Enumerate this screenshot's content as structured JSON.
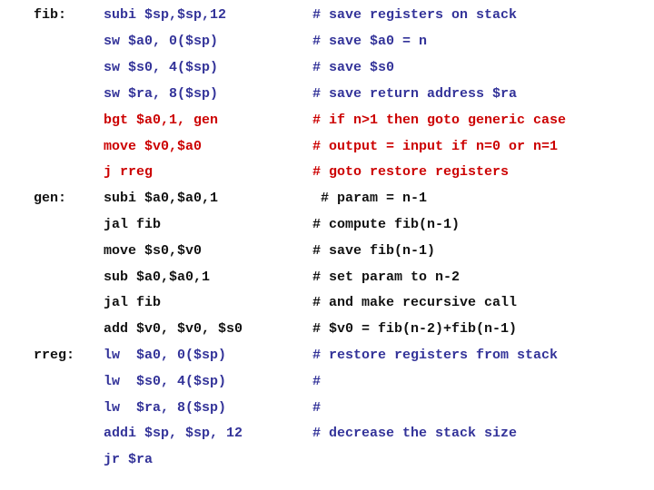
{
  "colors": {
    "blue": "#333399",
    "red": "#cc0000",
    "black": "#111111"
  },
  "lines": [
    {
      "label": "fib:",
      "code": "subi $sp,$sp,12",
      "comment": "# save registers on stack",
      "color": "blue"
    },
    {
      "label": "",
      "code": "sw $a0, 0($sp)",
      "comment": "# save $a0 = n",
      "color": "blue"
    },
    {
      "label": "",
      "code": "sw $s0, 4($sp)",
      "comment": "# save $s0",
      "color": "blue"
    },
    {
      "label": "",
      "code": "sw $ra, 8($sp)",
      "comment": "# save return address $ra",
      "color": "blue"
    },
    {
      "label": "",
      "code": "bgt $a0,1, gen",
      "comment": "# if n>1 then goto generic case",
      "color": "red"
    },
    {
      "label": "",
      "code": "move $v0,$a0",
      "comment": "# output = input if n=0 or n=1",
      "color": "red"
    },
    {
      "label": "",
      "code": "j rreg",
      "comment": "# goto restore registers",
      "color": "red"
    },
    {
      "label": "gen:",
      "code": "subi $a0,$a0,1",
      "comment": " # param = n-1",
      "color": "black"
    },
    {
      "label": "",
      "code": "jal fib",
      "comment": "# compute fib(n-1)",
      "color": "black"
    },
    {
      "label": "",
      "code": "move $s0,$v0",
      "comment": "# save fib(n-1)",
      "color": "black"
    },
    {
      "label": "",
      "code": "sub $a0,$a0,1",
      "comment": "# set param to n-2",
      "color": "black"
    },
    {
      "label": "",
      "code": "jal fib",
      "comment": "# and make recursive call",
      "color": "black"
    },
    {
      "label": "",
      "code": "add $v0, $v0, $s0",
      "comment": "# $v0 = fib(n-2)+fib(n-1)",
      "color": "black"
    },
    {
      "label": "rreg:",
      "code": "lw  $a0, 0($sp)",
      "comment": "# restore registers from stack",
      "color": "blue"
    },
    {
      "label": "",
      "code": "lw  $s0, 4($sp)",
      "comment": "#",
      "color": "blue"
    },
    {
      "label": "",
      "code": "lw  $ra, 8($sp)",
      "comment": "#",
      "color": "blue"
    },
    {
      "label": "",
      "code": "addi $sp, $sp, 12",
      "comment": "# decrease the stack size",
      "color": "blue"
    },
    {
      "label": "",
      "code": "jr $ra",
      "comment": "",
      "color": "blue"
    }
  ]
}
